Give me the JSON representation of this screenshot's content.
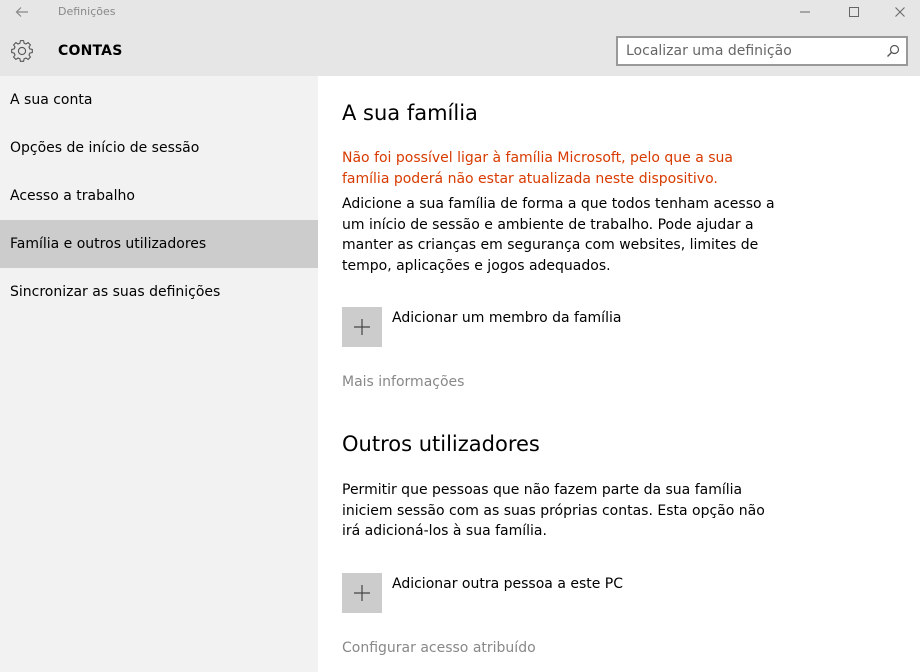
{
  "window": {
    "title": "Definições"
  },
  "header": {
    "title": "CONTAS",
    "search_placeholder": "Localizar uma definição"
  },
  "sidebar": {
    "items": [
      {
        "label": "A sua conta",
        "active": false
      },
      {
        "label": "Opções de início de sessão",
        "active": false
      },
      {
        "label": "Acesso a trabalho",
        "active": false
      },
      {
        "label": "Família e outros utilizadores",
        "active": true
      },
      {
        "label": "Sincronizar as suas definições",
        "active": false
      }
    ]
  },
  "family": {
    "title": "A sua família",
    "error": "Não foi possível ligar à família Microsoft, pelo que a sua família poderá não estar atualizada neste dispositivo.",
    "description": "Adicione a sua família de forma a que todos tenham acesso a um início de sessão e ambiente de trabalho. Pode ajudar a manter as crianças em segurança com websites, limites de tempo, aplicações e jogos adequados.",
    "add_label": "Adicionar um membro da família",
    "more_info": "Mais informações"
  },
  "others": {
    "title": "Outros utilizadores",
    "description": "Permitir que pessoas que não fazem parte da sua família iniciem sessão com as suas próprias contas. Esta opção não irá adicioná-los à sua família.",
    "add_label": "Adicionar outra pessoa a este PC",
    "assigned_access": "Configurar acesso atribuído"
  },
  "colors": {
    "error": "#d83b01",
    "active_nav": "#cccccc",
    "header_bg": "#e6e6e6",
    "link": "#888888"
  }
}
